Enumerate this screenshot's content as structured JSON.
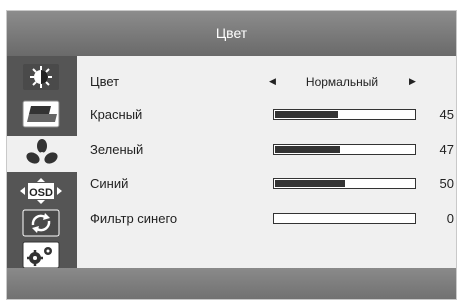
{
  "header": {
    "title": "Цвет"
  },
  "sidebar": {
    "items": [
      {
        "icon": "brightness-contrast-icon",
        "active": false
      },
      {
        "icon": "image-adjust-icon",
        "active": false
      },
      {
        "icon": "color-icon",
        "active": true
      },
      {
        "icon": "osd-settings-icon",
        "active": false
      },
      {
        "icon": "reset-icon",
        "active": false
      },
      {
        "icon": "system-settings-icon",
        "active": false
      }
    ]
  },
  "color_menu": {
    "mode": {
      "label": "Цвет",
      "value": "Нормальный"
    },
    "red": {
      "label": "Красный",
      "value": 45
    },
    "green": {
      "label": "Зеленый",
      "value": 47
    },
    "blue": {
      "label": "Синий",
      "value": 50
    },
    "blue_filter": {
      "label": "Фильтр синего",
      "value": 0
    }
  },
  "osd_icon_text": "OSD",
  "colors": {
    "title_bar": "#7a7a7a",
    "sidebar": "#555555",
    "panel": "#f0f0f0",
    "bar_fill": "#333333"
  }
}
